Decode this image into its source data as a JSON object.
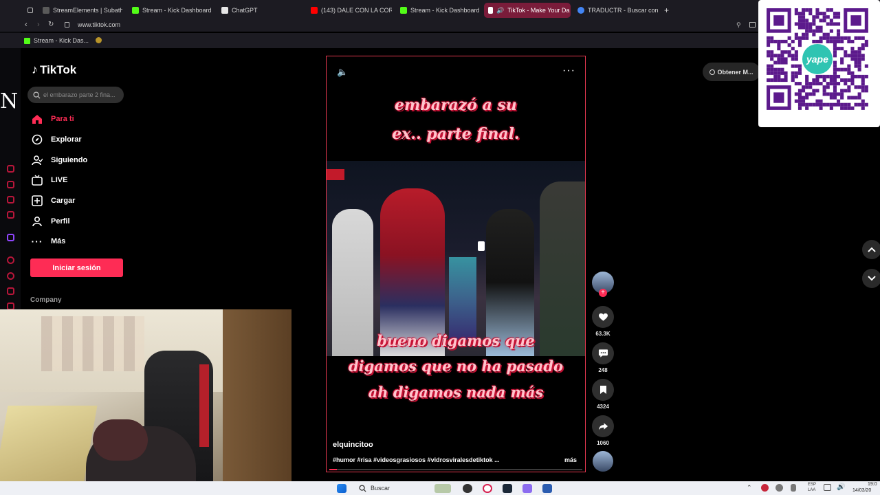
{
  "browser": {
    "tabs": [
      {
        "label": "StreamElements | Subatho",
        "color": "#5a5a5a"
      },
      {
        "label": "Stream - Kick Dashboard",
        "color": "#53fc18"
      },
      {
        "label": "ChatGPT",
        "color": "#e6e6e6"
      },
      {
        "label": "(143) DALE CON LA CORR",
        "color": "#ff0000"
      },
      {
        "label": "Stream - Kick Dashboard",
        "color": "#53fc18"
      },
      {
        "label": "TikTok - Make Your Da",
        "color": "#ffffff"
      },
      {
        "label": "TRADUCTR - Buscar con",
        "color": "#4285f4"
      }
    ],
    "url": "www.tiktok.com",
    "bookmark": "Stream - Kick Das...",
    "side_letter": "N",
    "accent": "#b8163a"
  },
  "tiktok": {
    "logo": "TikTok",
    "search_placeholder": "el embarazo parte 2 fina...",
    "nav": [
      {
        "label": "Para ti",
        "icon": "home-icon",
        "active": true
      },
      {
        "label": "Explorar",
        "icon": "compass-icon"
      },
      {
        "label": "Siguiendo",
        "icon": "following-icon"
      },
      {
        "label": "LIVE",
        "icon": "live-icon"
      },
      {
        "label": "Cargar",
        "icon": "upload-icon"
      },
      {
        "label": "Perfil",
        "icon": "profile-icon"
      },
      {
        "label": "Más",
        "icon": "more-icon"
      }
    ],
    "login": "Iniciar sesión",
    "company": "Company",
    "get_app": "Obtener M...",
    "brand_color": "#fe2c55"
  },
  "video": {
    "caption_top": [
      "embarazó a su",
      "ex.. parte final."
    ],
    "caption_bottom": [
      "bueno digamos que",
      "digamos que no ha pasado",
      "ah digamos nada más"
    ],
    "author": "elquincitoo",
    "description": "#humor #risa #videosgrasiosos #vidrosviralesdetiktok ...",
    "more": "más",
    "progress": 0.03,
    "actions": [
      {
        "icon": "heart-icon",
        "count": "63.3K"
      },
      {
        "icon": "comment-icon",
        "count": "248"
      },
      {
        "icon": "bookmark-icon",
        "count": "4324"
      },
      {
        "icon": "share-icon",
        "count": "1060"
      }
    ]
  },
  "qr": {
    "brand": "yape"
  },
  "taskbar": {
    "search": "Buscar",
    "lang": "ESP",
    "lang2": "LAA",
    "time": "19:0",
    "date": "14/03/20"
  }
}
